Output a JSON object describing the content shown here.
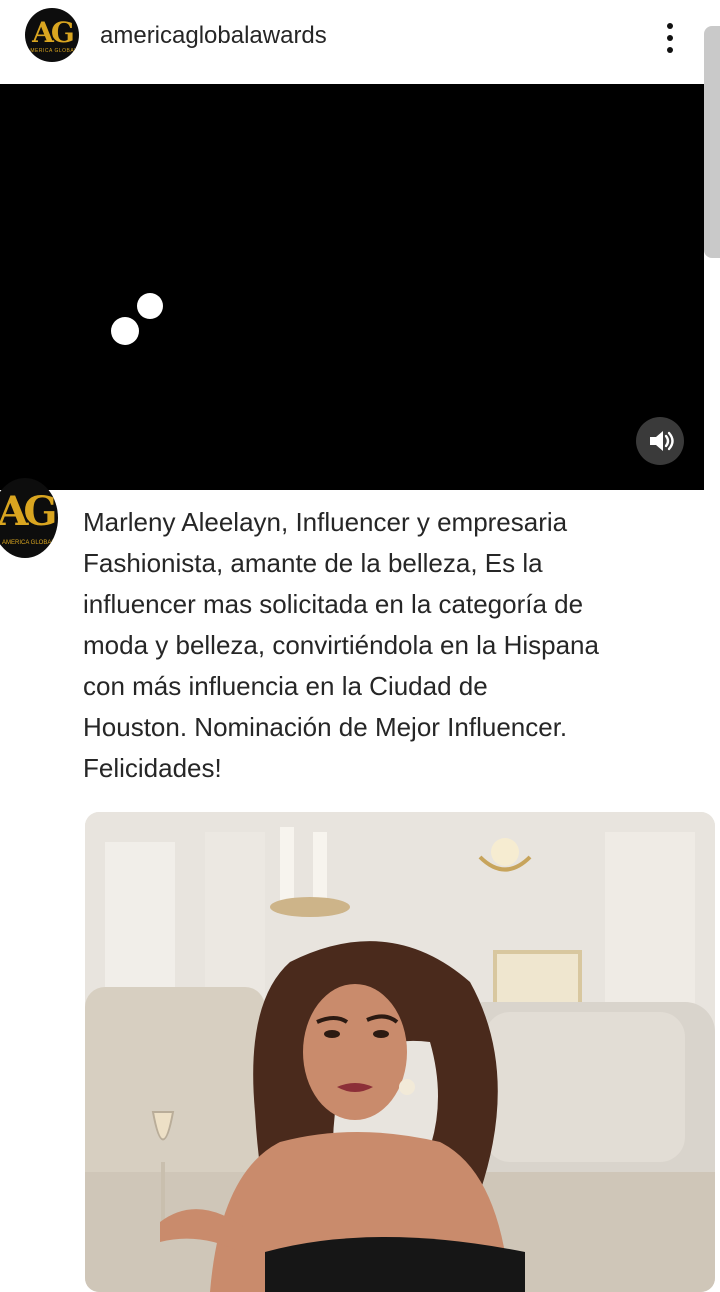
{
  "header": {
    "logo_text": "AG",
    "logo_sub": "AMERICA GLOBAL",
    "username": "americaglobalawards",
    "menu_icon": "kebab-menu-icon"
  },
  "video": {
    "loading_icon": "loading-dots-icon",
    "volume_icon": "volume-icon"
  },
  "post": {
    "avatar_text": "AG",
    "avatar_sub": "AMERICA GLOBAL",
    "caption_lines": [
      "Marleny Aleelayn, Influencer y empresaria",
      " Fashionista, amante de la belleza, Es la",
      "influencer mas solicitada en la categoría de",
      "moda y belleza, convirtiéndola en la Hispana",
      "con más influencia en la Ciudad de",
      "Houston. Nominación de Mejor Influencer.",
      "Felicidades!"
    ],
    "photo_alt": ""
  }
}
